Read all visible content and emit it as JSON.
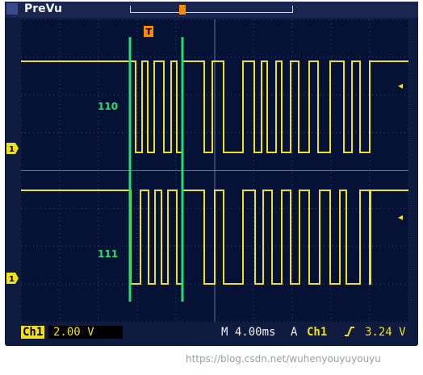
{
  "header": {
    "status_label": "PreVu",
    "trigger_marker_label": "T"
  },
  "channel1": {
    "badge": "Ch1",
    "scale": "2.00 V",
    "ground_marker_label": "1"
  },
  "cursors": {
    "label_top": "110",
    "label_bottom": "111"
  },
  "footer": {
    "timebase": "M 4.00ms",
    "trigger_source_prefix": "A",
    "trigger_channel": "Ch1",
    "trigger_slope": "rising",
    "trigger_level": "3.24 V"
  },
  "watermark": "https://blog.csdn.net/wuhenyouyuyouyu",
  "colors": {
    "trace": "#f0e020",
    "cursor": "#22e06a",
    "trigger": "#ff8a00",
    "grid": "#3a4a7a"
  }
}
